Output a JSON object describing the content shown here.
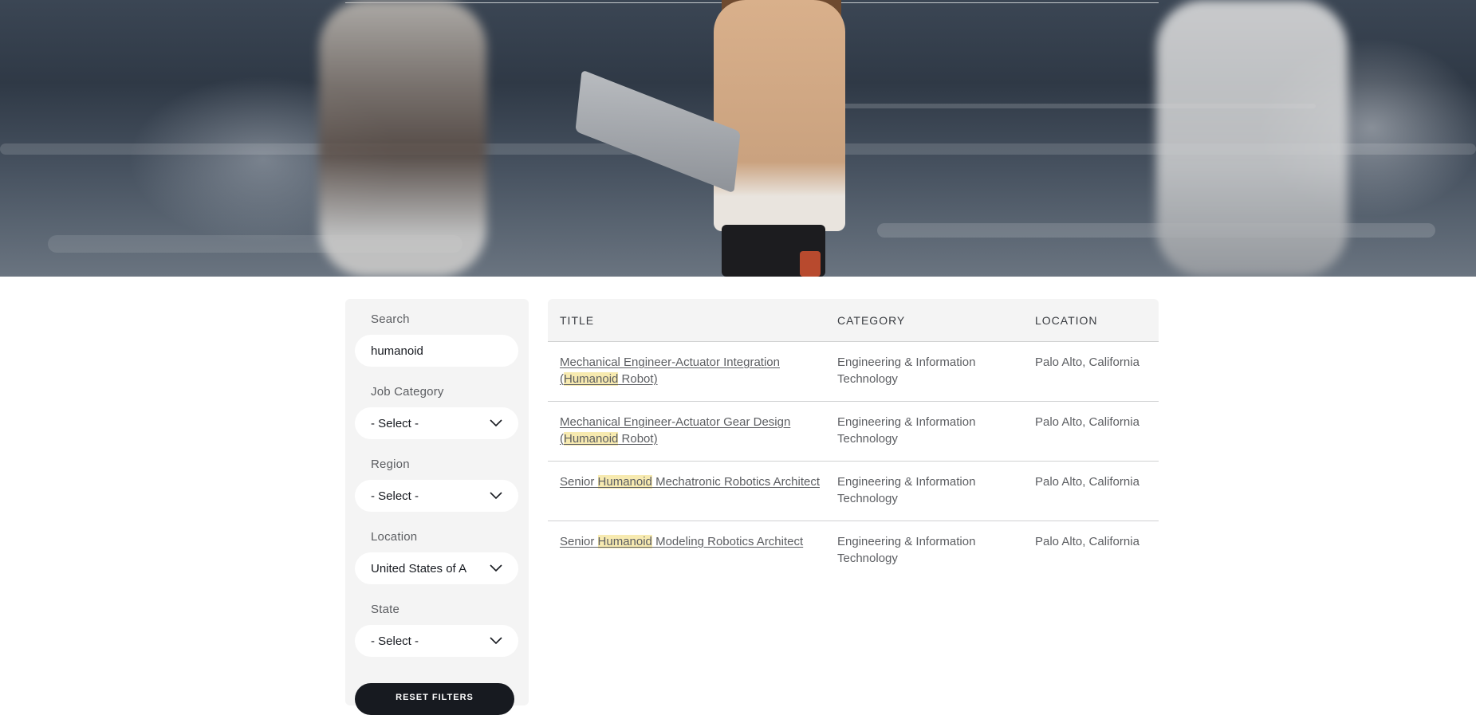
{
  "sidebar": {
    "search_label": "Search",
    "search_value": "humanoid",
    "filters": [
      {
        "label": "Job Category",
        "value": "- Select -"
      },
      {
        "label": "Region",
        "value": "- Select -"
      },
      {
        "label": "Location",
        "value": "United States of A"
      },
      {
        "label": "State",
        "value": "- Select -"
      }
    ],
    "reset_label": "RESET FILTERS"
  },
  "table": {
    "headers": {
      "title": "TITLE",
      "category": "CATEGORY",
      "location": "LOCATION"
    },
    "highlight_term": "Humanoid",
    "rows": [
      {
        "title_pre": "Mechanical Engineer-Actuator Integration (",
        "title_hl": "Humanoid",
        "title_post": " Robot)",
        "category": "Engineering & Information Technology",
        "location": "Palo Alto, California"
      },
      {
        "title_pre": "Mechanical Engineer-Actuator Gear Design (",
        "title_hl": "Humanoid",
        "title_post": " Robot)",
        "category": "Engineering & Information Technology",
        "location": "Palo Alto, California"
      },
      {
        "title_pre": "Senior ",
        "title_hl": "Humanoid",
        "title_post": " Mechatronic Robotics Architect",
        "category": "Engineering & Information Technology",
        "location": "Palo Alto, California"
      },
      {
        "title_pre": "Senior ",
        "title_hl": "Humanoid",
        "title_post": " Modeling Robotics Architect",
        "category": "Engineering & Information Technology",
        "location": "Palo Alto, California"
      }
    ]
  },
  "colors": {
    "accent_dark": "#171a20",
    "highlight": "#f7eab0",
    "panel_bg": "#f4f4f4"
  },
  "icons": {
    "dropdown": "chevron-down-icon"
  }
}
